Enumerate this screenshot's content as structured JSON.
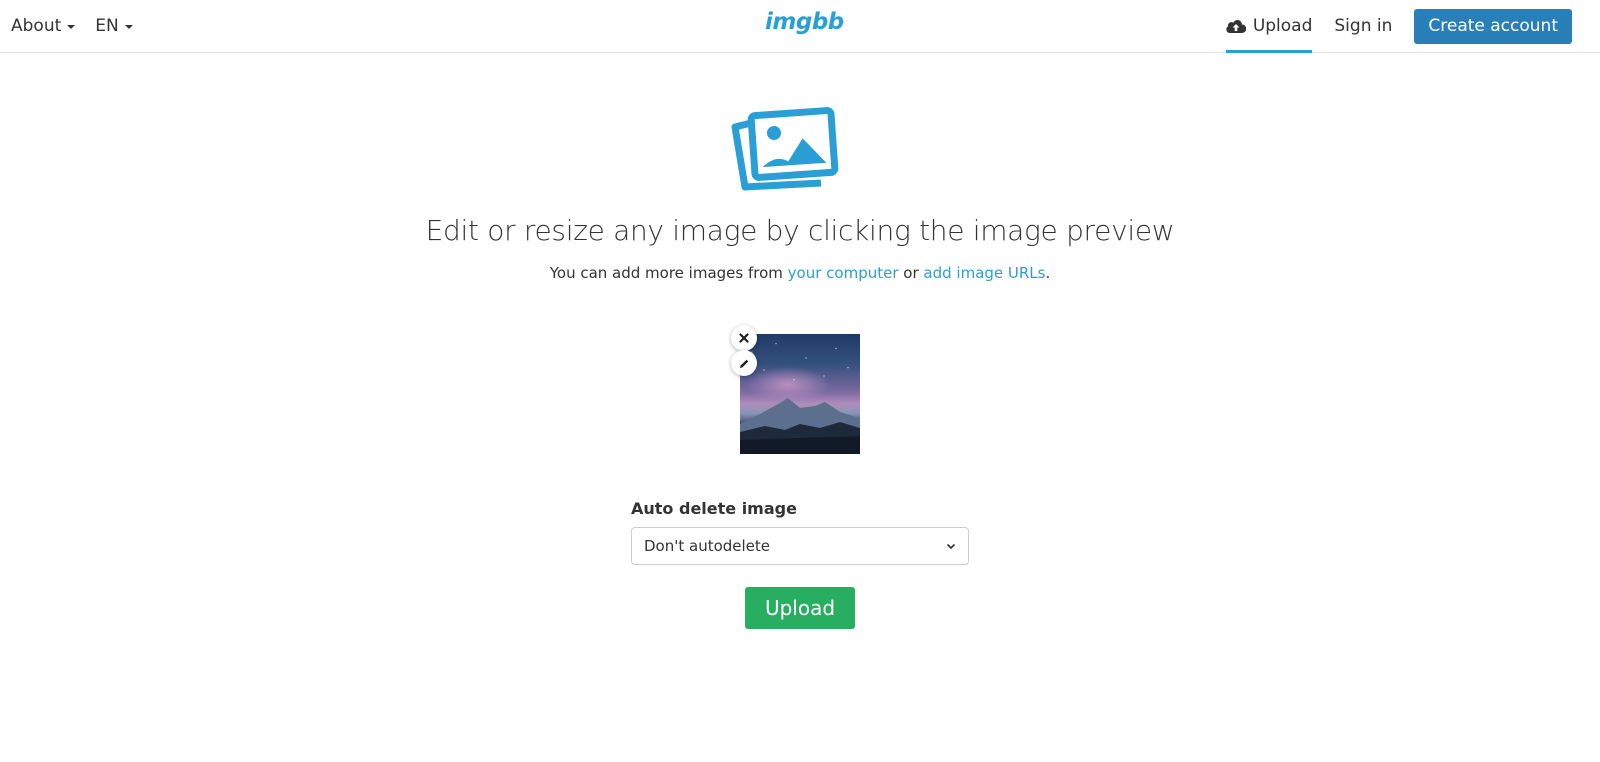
{
  "header": {
    "about_label": "About",
    "language_label": "EN",
    "logo_text": "imgbb",
    "upload_label": "Upload",
    "signin_label": "Sign in",
    "create_account_label": "Create account"
  },
  "main": {
    "headline": "Edit or resize any image by clicking the image preview",
    "subline_prefix": "You can add more images from ",
    "link_computer": "your computer",
    "subline_or": " or ",
    "link_urls": "add image URLs",
    "subline_suffix": "."
  },
  "form": {
    "auto_delete_label": "Auto delete image",
    "auto_delete_value": "Don't autodelete",
    "upload_button": "Upload"
  },
  "colors": {
    "accent": "#2a9fd6",
    "create_account_bg": "#2980b9",
    "upload_button_bg": "#27ae60"
  }
}
